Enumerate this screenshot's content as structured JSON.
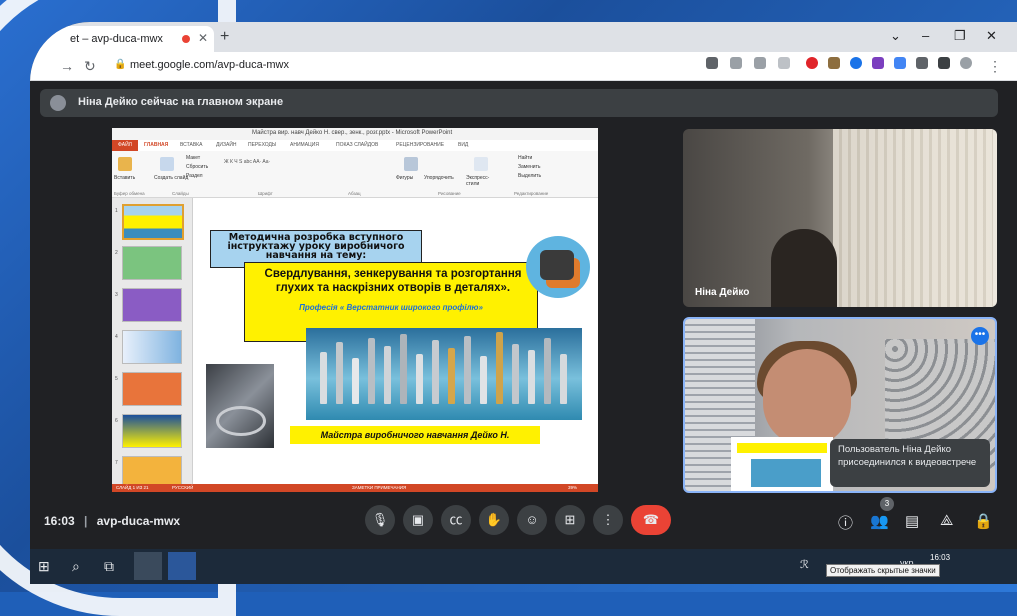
{
  "browser": {
    "tab_title": "et – avp-duca-mwx",
    "new_tab": "+",
    "close_tab": "✕",
    "url": "meet.google.com/avp-duca-mwx",
    "window_controls": [
      "⌄",
      "–",
      "❐",
      "✕"
    ]
  },
  "meet": {
    "banner_text": "Ніна Дейко сейчас на главном экране",
    "meeting_code": "avp-duca-mwx",
    "clock": "16:03",
    "separator": "|",
    "participants_count": "3",
    "tiles": [
      {
        "name": "Ніна Дейко"
      },
      {
        "name": ""
      }
    ],
    "toast": "Пользователь Ніна Дейко присоединился к видеовстрече",
    "more_icon": "•••"
  },
  "powerpoint": {
    "window_title": "Майстра вир. навч Дейко Н. свер., зенк., розг.pptx - Microsoft PowerPoint",
    "file_tab": "ФАЙЛ",
    "tabs": [
      "ГЛАВНАЯ",
      "ВСТАВКА",
      "ДИЗАЙН",
      "ПЕРЕХОДЫ",
      "АНИМАЦИЯ",
      "ПОКАЗ СЛАЙДОВ",
      "РЕЦЕНЗИРОВАНИЕ",
      "ВИД"
    ],
    "ribbon_items": [
      "Вставить",
      "Создать слайд",
      "Макет",
      "Сбросить",
      "Раздел",
      "Фигуры",
      "Упорядочить",
      "Экспресс-стили",
      "Найти",
      "Заменить",
      "Выделить"
    ],
    "ribbon_groups": [
      "Буфер обмена",
      "Слайды",
      "Шрифт",
      "Абзац",
      "Рисование",
      "Редактирование"
    ],
    "thumbnail_numbers": [
      "1",
      "2",
      "3",
      "4",
      "5",
      "6",
      "7"
    ],
    "status_left": "СЛАЙД 1 ИЗ 21",
    "status_lang": "РУССКИЙ",
    "status_right": "ЗАМЕТКИ   ПРИМЕЧАНИЯ",
    "status_zoom": "39%"
  },
  "slide": {
    "box_title": "Методична розробка вступного інструктажу уроку виробничого навчання на тему:",
    "heading": "Свердлування, зенкерування та розгортання глухих  та наскрізних отворів в деталях».",
    "profession": "Професія « Верстатник широкого профілю»",
    "footer": "Майстра виробничого навчання Дейко Н."
  },
  "taskbar": {
    "time": "16:03",
    "tray": "укр",
    "tooltip": "Отображать скрытые значки"
  },
  "colors": {
    "meet_bg": "#202124",
    "end_call": "#ea4335",
    "ppt_accent": "#d24726",
    "slide_yellow": "#fff100",
    "slide_blue": "#a7d3ef"
  }
}
